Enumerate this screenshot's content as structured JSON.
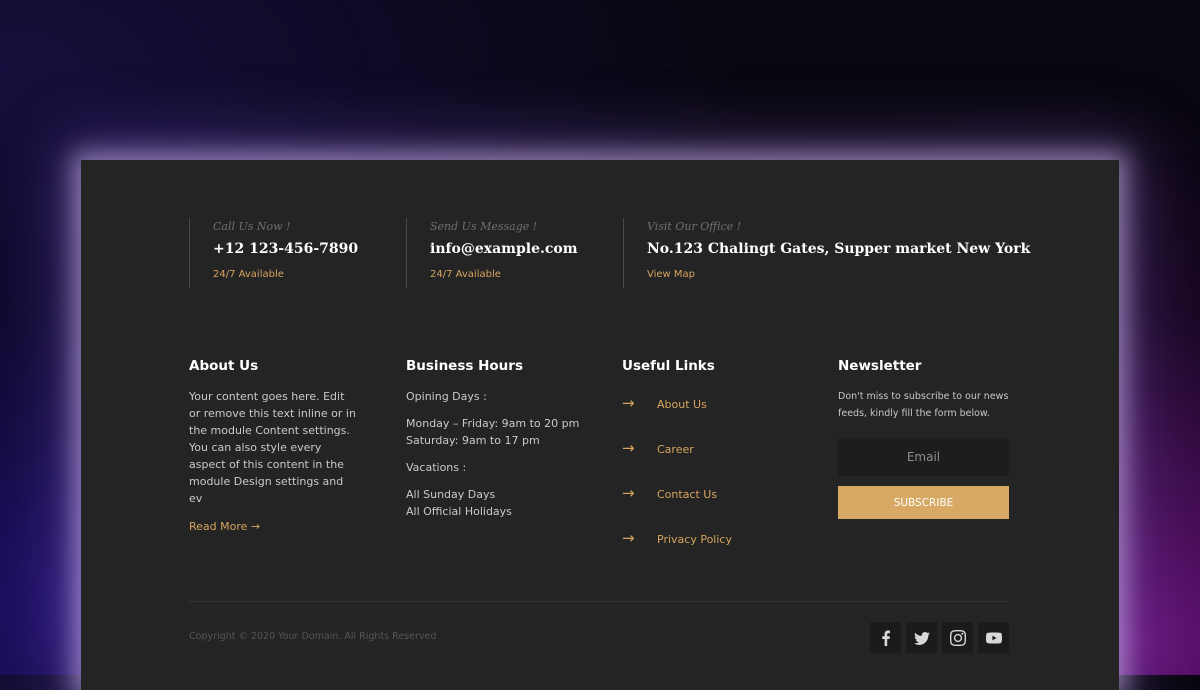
{
  "contacts": [
    {
      "label": "Call Us Now !",
      "value": "+12 123-456-7890",
      "sub": "24/7 Available"
    },
    {
      "label": "Send Us Message !",
      "value": "info@example.com",
      "sub": "24/7 Available"
    },
    {
      "label": "Visit Our Office !",
      "value": "No.123 Chalingt Gates, Supper market New York",
      "sub": "View Map"
    }
  ],
  "about": {
    "title": "About Us",
    "text": "Your content goes here. Edit or remove this text inline or in the module Content settings. You can also style every aspect of this content in the module Design settings and ev",
    "read_more": "Read More →"
  },
  "hours": {
    "title": "Business Hours",
    "opening_label": "Opining Days :",
    "weekdays": "Monday – Friday: 9am to 20 pm",
    "saturday": "Saturday: 9am to 17 pm",
    "vacations_label": "Vacations :",
    "vac1": "All Sunday Days",
    "vac2": "All Official Holidays"
  },
  "links": {
    "title": "Useful Links",
    "arrow": "→",
    "items": [
      "About Us",
      "Career",
      "Contact Us",
      "Privacy Policy"
    ]
  },
  "newsletter": {
    "title": "Newsletter",
    "text": "Don't miss to subscribe to our news feeds, kindly fill the form below.",
    "email_placeholder": "Email",
    "button": "SUBSCRIBE"
  },
  "copyright": "Copyright © 2020 Your Domain. All Rights Reserved",
  "social_icons": [
    "facebook-icon",
    "twitter-icon",
    "instagram-icon",
    "youtube-icon"
  ],
  "colors": {
    "accent": "#d6a45e",
    "panel": "#242424",
    "button": "#d7a965"
  }
}
